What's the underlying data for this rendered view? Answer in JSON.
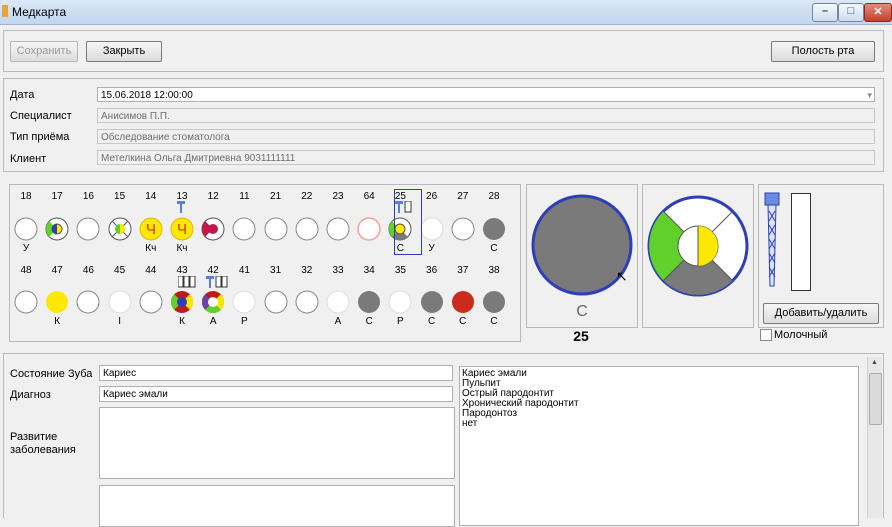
{
  "window": {
    "title": "Медкарта"
  },
  "toolbar": {
    "save_label": "Сохранить",
    "close_label": "Закрыть",
    "oral_cavity_label": "Полость рта"
  },
  "form": {
    "date_label": "Дата",
    "date_value": "15.06.2018 12:00:00",
    "specialist_label": "Специалист",
    "specialist_value": "Анисимов П.П.",
    "visit_type_label": "Тип приёма",
    "visit_type_value": "Обследование стоматолога",
    "client_label": "Клиент",
    "client_value": "Метелкина Ольга Дмитриевна 9031111111"
  },
  "teeth": {
    "upper": [
      {
        "n": "18",
        "cond": "У",
        "style": "white"
      },
      {
        "n": "17",
        "cond": "",
        "style": "quad-green"
      },
      {
        "n": "16",
        "cond": "",
        "style": "white"
      },
      {
        "n": "15",
        "cond": "",
        "style": "cross"
      },
      {
        "n": "14",
        "cond": "Кч",
        "style": "crown"
      },
      {
        "n": "13",
        "cond": "Кч",
        "style": "crown"
      },
      {
        "n": "12",
        "cond": "",
        "style": "red-mark"
      },
      {
        "n": "11",
        "cond": "",
        "style": "white"
      },
      {
        "n": "21",
        "cond": "",
        "style": "white"
      },
      {
        "n": "22",
        "cond": "",
        "style": "white"
      },
      {
        "n": "23",
        "cond": "",
        "style": "white"
      },
      {
        "n": "64",
        "cond": "",
        "style": "pink"
      },
      {
        "n": "25",
        "cond": "С",
        "style": "selected"
      },
      {
        "n": "26",
        "cond": "У",
        "style": "white-plain"
      },
      {
        "n": "27",
        "cond": "",
        "style": "white"
      },
      {
        "n": "28",
        "cond": "С",
        "style": "gray"
      }
    ],
    "lower": [
      {
        "n": "48",
        "cond": "",
        "style": "white"
      },
      {
        "n": "47",
        "cond": "К",
        "style": "yellow"
      },
      {
        "n": "46",
        "cond": "",
        "style": "white"
      },
      {
        "n": "45",
        "cond": "I",
        "style": "white-plain"
      },
      {
        "n": "44",
        "cond": "",
        "style": "white"
      },
      {
        "n": "43",
        "cond": "К",
        "style": "quad-multi"
      },
      {
        "n": "42",
        "cond": "А",
        "style": "quad-multi2"
      },
      {
        "n": "41",
        "cond": "Р",
        "style": "white-plain"
      },
      {
        "n": "31",
        "cond": "",
        "style": "white"
      },
      {
        "n": "32",
        "cond": "",
        "style": "white"
      },
      {
        "n": "33",
        "cond": "А",
        "style": "white-plain"
      },
      {
        "n": "34",
        "cond": "С",
        "style": "gray"
      },
      {
        "n": "35",
        "cond": "Р",
        "style": "white-plain"
      },
      {
        "n": "36",
        "cond": "С",
        "style": "gray"
      },
      {
        "n": "37",
        "cond": "С",
        "style": "dark-red"
      },
      {
        "n": "38",
        "cond": "С",
        "style": "gray"
      }
    ]
  },
  "detail": {
    "letter": "С",
    "number": "25"
  },
  "side": {
    "add_remove_label": "Добавить/удалить",
    "milk_label": "Молочный"
  },
  "bottom": {
    "state_label": "Состояние Зуба",
    "state_value": "Кариес",
    "diagnosis_label": "Диагноз",
    "diagnosis_value": "Кариес эмали",
    "development_label": "Развитие заболевания",
    "list": [
      "Кариес эмали",
      "Пульпит",
      "Острый пародонтит",
      "Хронический пародонтит",
      "Пародонтоз",
      "нет"
    ]
  },
  "colors": {
    "gray": "#7a7a7a",
    "yellow": "#fce800",
    "green": "#5fd12a",
    "red": "#cc2a1a",
    "blue": "#2c3fb8"
  }
}
